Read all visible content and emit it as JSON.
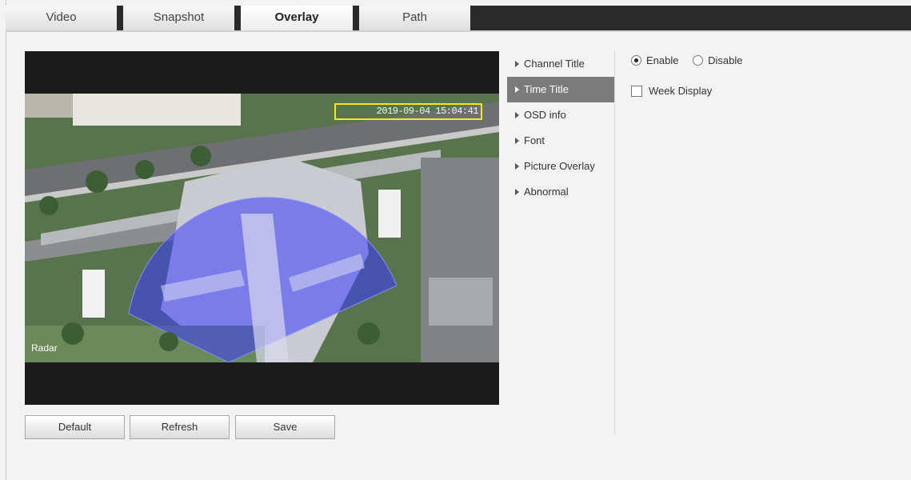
{
  "tabs": [
    {
      "label": "Video",
      "active": false
    },
    {
      "label": "Snapshot",
      "active": false
    },
    {
      "label": "Overlay",
      "active": true
    },
    {
      "label": "Path",
      "active": false
    }
  ],
  "video": {
    "osd_time_text": "2019-09-04 15:04:41",
    "radar_label": "Radar"
  },
  "buttons": {
    "default_label": "Default",
    "refresh_label": "Refresh",
    "save_label": "Save"
  },
  "menu": {
    "items": [
      {
        "label": "Channel Title",
        "active": false
      },
      {
        "label": "Time Title",
        "active": true
      },
      {
        "label": "OSD info",
        "active": false
      },
      {
        "label": "Font",
        "active": false
      },
      {
        "label": "Picture Overlay",
        "active": false
      },
      {
        "label": "Abnormal",
        "active": false
      }
    ]
  },
  "options": {
    "enable_label": "Enable",
    "disable_label": "Disable",
    "selected": "Enable",
    "week_display_label": "Week Display",
    "week_display_checked": false
  },
  "colors": {
    "tab_bar_bg": "#2a2a2a",
    "active_menu_bg": "#7b7b7b",
    "osd_box_border": "#f0ea1a",
    "radar_overlay": "#3a3aff"
  }
}
